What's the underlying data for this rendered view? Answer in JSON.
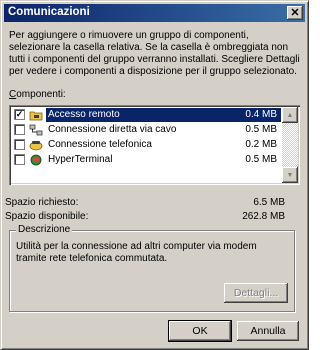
{
  "window": {
    "title": "Comunicazioni",
    "close_glyph": "✕"
  },
  "intro_text": "Per aggiungere o rimuovere un gruppo di componenti, selezionare la casella relativa. Se la casella è ombreggiata non tutti i componenti del gruppo verranno installati. Scegliere Dettagli per vedere i componenti a disposizione per il gruppo selezionato.",
  "components_label": {
    "underlined": "C",
    "rest": "omponenti:"
  },
  "components": [
    {
      "name": "Accesso remoto",
      "size": "0.4 MB",
      "checked": true,
      "selected": true,
      "icon": "folder-phone-icon"
    },
    {
      "name": "Connessione diretta via cavo",
      "size": "0.5 MB",
      "checked": false,
      "selected": false,
      "icon": "cable-connection-icon"
    },
    {
      "name": "Connessione telefonica",
      "size": "0.2 MB",
      "checked": false,
      "selected": false,
      "icon": "phone-dialer-icon"
    },
    {
      "name": "HyperTerminal",
      "size": "0.5 MB",
      "checked": false,
      "selected": false,
      "icon": "hyperterminal-icon"
    }
  ],
  "space": {
    "required_label": "Spazio richiesto:",
    "required_value": "6.5 MB",
    "available_label": "Spazio disponibile:",
    "available_value": "262.8 MB"
  },
  "description": {
    "legend": "Descrizione",
    "text": "Utilità per la connessione ad altri computer via modem tramite rete telefonica commutata."
  },
  "buttons": {
    "details": "Dettagli...",
    "ok": "OK",
    "cancel": "Annulla"
  },
  "colors": {
    "face": "#d4d0c8",
    "selection": "#0a246a",
    "title_start": "#0a246a",
    "title_end": "#3a6ea5"
  }
}
